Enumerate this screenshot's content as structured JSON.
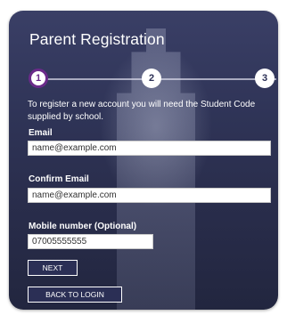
{
  "title": "Parent Registration",
  "steps": [
    "1",
    "2",
    "3"
  ],
  "intro_text": "To register a new account you will need the Student Code supplied by school.",
  "email": {
    "label": "Email",
    "value": "name@example.com"
  },
  "confirm_email": {
    "label": "Confirm Email",
    "value": "name@example.com"
  },
  "mobile": {
    "label": "Mobile number (Optional)",
    "value": "07005555555"
  },
  "buttons": {
    "next": "NEXT",
    "back": "BACK TO LOGIN"
  },
  "colors": {
    "panel": "#2b2f55",
    "active_step": "#6a2a8a"
  }
}
